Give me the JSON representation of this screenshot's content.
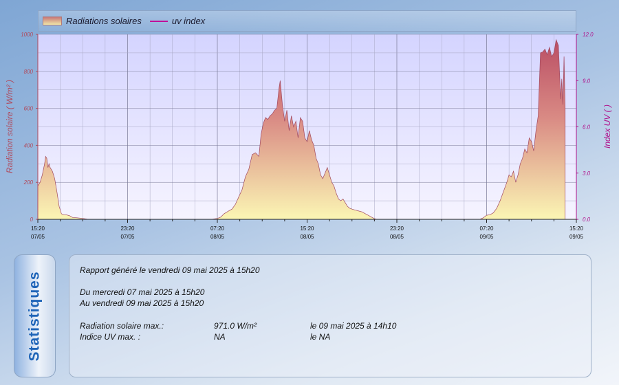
{
  "legend": {
    "radiation": "Radiations solaires",
    "uv": "uv index"
  },
  "colors": {
    "fill_top": "#c76b73",
    "fill_bottom": "#f8f2b8",
    "uv_line": "#c0109a",
    "axis_left": "#b0485a",
    "axis_right": "#b0108a"
  },
  "chart_data": {
    "type": "area",
    "ylabel": "Radiation solaire ( W/m² )",
    "y2label": "Index UV ( )",
    "ylim": [
      0,
      1000
    ],
    "y2lim": [
      0,
      12
    ],
    "y_ticks": [
      "0",
      "200",
      "400",
      "600",
      "800",
      "1000"
    ],
    "y2_ticks": [
      "0.0",
      "3.0",
      "6.0",
      "9.0",
      "12.0"
    ],
    "x_ticks": [
      {
        "time": "15:20",
        "date": "07/05"
      },
      {
        "time": "23:20",
        "date": "07/05"
      },
      {
        "time": "07:20",
        "date": "08/05"
      },
      {
        "time": "15:20",
        "date": "08/05"
      },
      {
        "time": "23:20",
        "date": "08/05"
      },
      {
        "time": "07:20",
        "date": "09/05"
      },
      {
        "time": "15:20",
        "date": "09/05"
      }
    ],
    "x_range_hours": [
      0,
      48
    ],
    "grid": true,
    "legend_position": "top",
    "series": [
      {
        "name": "Radiations solaires",
        "points": [
          [
            0,
            180
          ],
          [
            0.2,
            200
          ],
          [
            0.4,
            240
          ],
          [
            0.6,
            300
          ],
          [
            0.7,
            340
          ],
          [
            0.8,
            330
          ],
          [
            0.9,
            280
          ],
          [
            1.0,
            300
          ],
          [
            1.1,
            280
          ],
          [
            1.3,
            260
          ],
          [
            1.5,
            220
          ],
          [
            1.7,
            150
          ],
          [
            1.9,
            70
          ],
          [
            2.1,
            30
          ],
          [
            2.3,
            25
          ],
          [
            2.5,
            25
          ],
          [
            2.8,
            20
          ],
          [
            3.1,
            10
          ],
          [
            3.5,
            8
          ],
          [
            4.0,
            5
          ],
          [
            4.3,
            2
          ],
          [
            4.5,
            0
          ],
          [
            15.5,
            0
          ],
          [
            16.0,
            5
          ],
          [
            16.3,
            12
          ],
          [
            16.6,
            30
          ],
          [
            17.0,
            45
          ],
          [
            17.3,
            55
          ],
          [
            17.6,
            80
          ],
          [
            17.9,
            120
          ],
          [
            18.2,
            160
          ],
          [
            18.5,
            230
          ],
          [
            18.8,
            270
          ],
          [
            19.1,
            350
          ],
          [
            19.4,
            360
          ],
          [
            19.7,
            340
          ],
          [
            19.9,
            460
          ],
          [
            20.1,
            520
          ],
          [
            20.3,
            550
          ],
          [
            20.5,
            540
          ],
          [
            20.7,
            560
          ],
          [
            20.9,
            570
          ],
          [
            21.1,
            590
          ],
          [
            21.3,
            600
          ],
          [
            21.5,
            710
          ],
          [
            21.6,
            750
          ],
          [
            21.8,
            620
          ],
          [
            22.0,
            530
          ],
          [
            22.2,
            590
          ],
          [
            22.4,
            480
          ],
          [
            22.6,
            560
          ],
          [
            22.8,
            500
          ],
          [
            23.0,
            530
          ],
          [
            23.2,
            440
          ],
          [
            23.4,
            550
          ],
          [
            23.6,
            530
          ],
          [
            23.8,
            440
          ],
          [
            24.0,
            420
          ],
          [
            24.2,
            480
          ],
          [
            24.4,
            430
          ],
          [
            24.6,
            400
          ],
          [
            24.8,
            330
          ],
          [
            25.0,
            300
          ],
          [
            25.2,
            240
          ],
          [
            25.4,
            220
          ],
          [
            25.6,
            250
          ],
          [
            25.8,
            280
          ],
          [
            26.0,
            240
          ],
          [
            26.2,
            200
          ],
          [
            26.4,
            180
          ],
          [
            26.6,
            140
          ],
          [
            26.8,
            110
          ],
          [
            27.0,
            100
          ],
          [
            27.2,
            110
          ],
          [
            27.4,
            90
          ],
          [
            27.6,
            70
          ],
          [
            27.8,
            60
          ],
          [
            28.0,
            55
          ],
          [
            28.3,
            50
          ],
          [
            28.6,
            45
          ],
          [
            28.9,
            40
          ],
          [
            29.2,
            30
          ],
          [
            29.5,
            20
          ],
          [
            29.8,
            10
          ],
          [
            30.0,
            4
          ],
          [
            30.2,
            0
          ],
          [
            39.4,
            0
          ],
          [
            39.7,
            8
          ],
          [
            40.0,
            22
          ],
          [
            40.3,
            25
          ],
          [
            40.6,
            35
          ],
          [
            40.9,
            60
          ],
          [
            41.2,
            100
          ],
          [
            41.5,
            150
          ],
          [
            41.8,
            200
          ],
          [
            42.0,
            240
          ],
          [
            42.2,
            230
          ],
          [
            42.4,
            260
          ],
          [
            42.6,
            200
          ],
          [
            42.8,
            240
          ],
          [
            43.0,
            300
          ],
          [
            43.2,
            330
          ],
          [
            43.4,
            380
          ],
          [
            43.6,
            360
          ],
          [
            43.8,
            440
          ],
          [
            44.0,
            420
          ],
          [
            44.2,
            370
          ],
          [
            44.4,
            480
          ],
          [
            44.6,
            560
          ],
          [
            44.8,
            900
          ],
          [
            45.0,
            905
          ],
          [
            45.2,
            920
          ],
          [
            45.4,
            890
          ],
          [
            45.6,
            930
          ],
          [
            45.8,
            880
          ],
          [
            46.0,
            900
          ],
          [
            46.2,
            971
          ],
          [
            46.4,
            940
          ],
          [
            46.6,
            650
          ],
          [
            46.7,
            760
          ],
          [
            46.8,
            620
          ],
          [
            46.9,
            880
          ],
          [
            47.0,
            600
          ]
        ]
      },
      {
        "name": "uv index",
        "points": []
      }
    ]
  },
  "stats": {
    "tab_label": "Statistiques",
    "report_line": "Rapport généré le vendredi 09 mai 2025 à 15h20",
    "from_line": "Du mercredi 07 mai 2025 à 15h20",
    "to_line": "Au vendredi 09 mai 2025 à 15h20",
    "rows": [
      {
        "label": "Radiation solaire max.:",
        "value": "971.0 W/m²",
        "when": "le 09 mai 2025 à 14h10"
      },
      {
        "label": "Indice UV max. :",
        "value": "NA",
        "when": "le NA"
      }
    ]
  }
}
